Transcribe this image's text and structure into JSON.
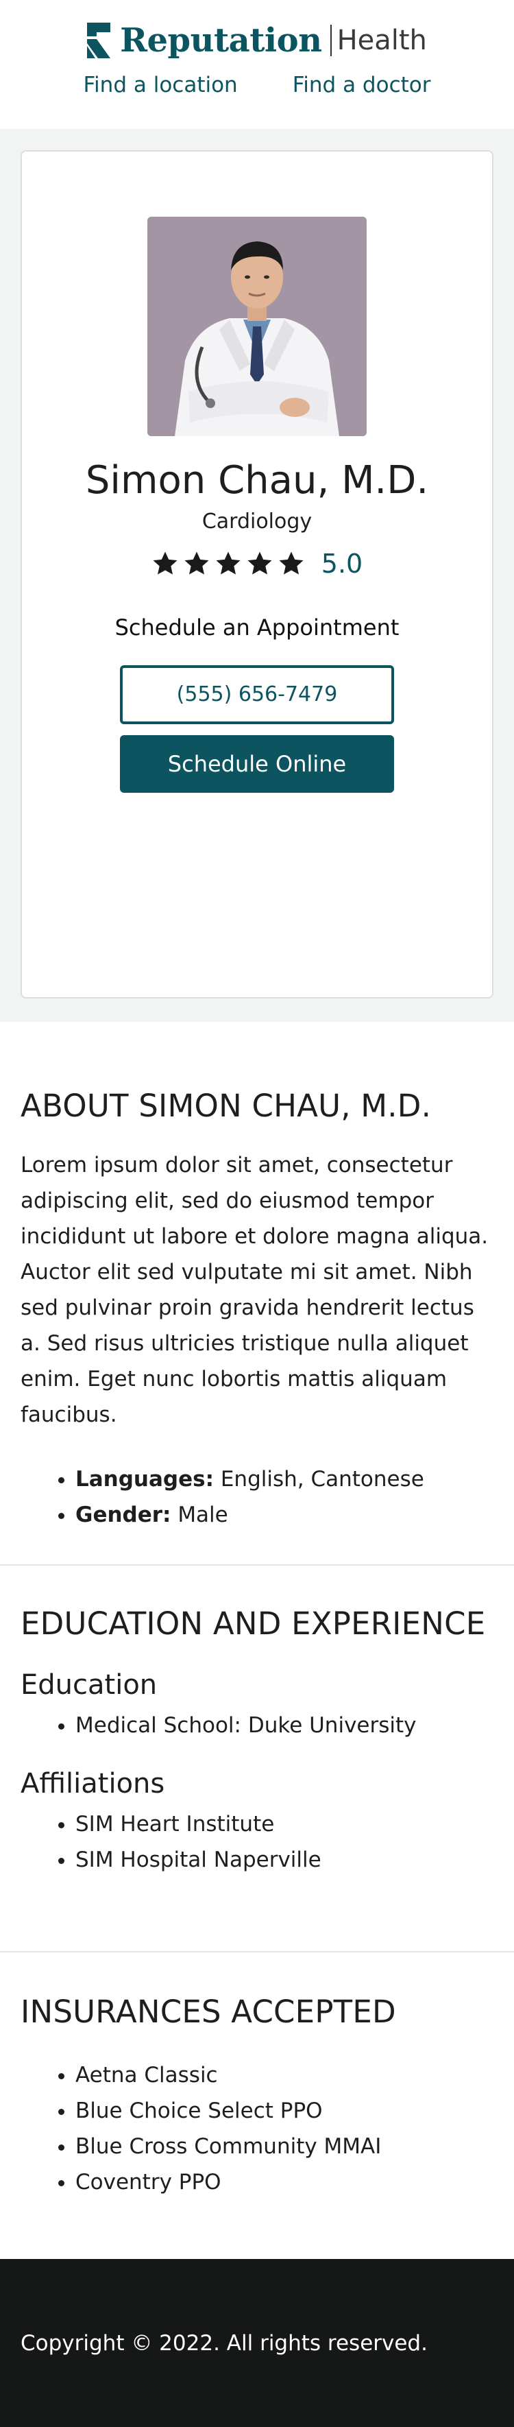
{
  "header": {
    "logo_word": "Reputation",
    "logo_sub": "Health",
    "nav": [
      {
        "label": "Find a location"
      },
      {
        "label": "Find a doctor"
      }
    ]
  },
  "doctor": {
    "photo_icon": "doctor-portrait",
    "name": "Simon Chau, M.D.",
    "specialty": "Cardiology",
    "rating": {
      "stars": 5,
      "max": 5,
      "value": "5.0"
    },
    "schedule_heading": "Schedule an Appointment",
    "phone": "(555) 656-7479",
    "schedule_button": "Schedule Online"
  },
  "about": {
    "title": "ABOUT SIMON CHAU, M.D.",
    "text": "Lorem ipsum dolor sit amet, consectetur adipiscing elit, sed do eiusmod tempor incididunt ut labore et dolore magna aliqua. Auctor elit sed vulputate mi sit amet. Nibh sed pulvinar proin gravida hendrerit lectus a. Sed risus ultricies tristique nulla aliquet enim. Eget nunc lobortis mattis aliquam faucibus.",
    "facts": [
      {
        "label": "Languages:",
        "value": "English, Cantonese"
      },
      {
        "label": "Gender:",
        "value": "Male"
      }
    ]
  },
  "education": {
    "title": "EDUCATION AND EXPERIENCE",
    "education_heading": "Education",
    "education_items": [
      "Medical School: Duke University"
    ],
    "affiliations_heading": "Affiliations",
    "affiliations_items": [
      "SIM Heart Institute",
      "SIM Hospital Naperville"
    ]
  },
  "insurance": {
    "title": "INSURANCES ACCEPTED",
    "items": [
      "Aetna Classic",
      "Blue Choice Select PPO",
      "Blue Cross Community MMAI",
      "Coventry PPO"
    ]
  },
  "footer": {
    "copyright": "Copyright © 2022. All rights reserved."
  },
  "colors": {
    "brand": "#0b5460",
    "card_bg": "#f2f3f3",
    "footer_bg": "#161717"
  }
}
